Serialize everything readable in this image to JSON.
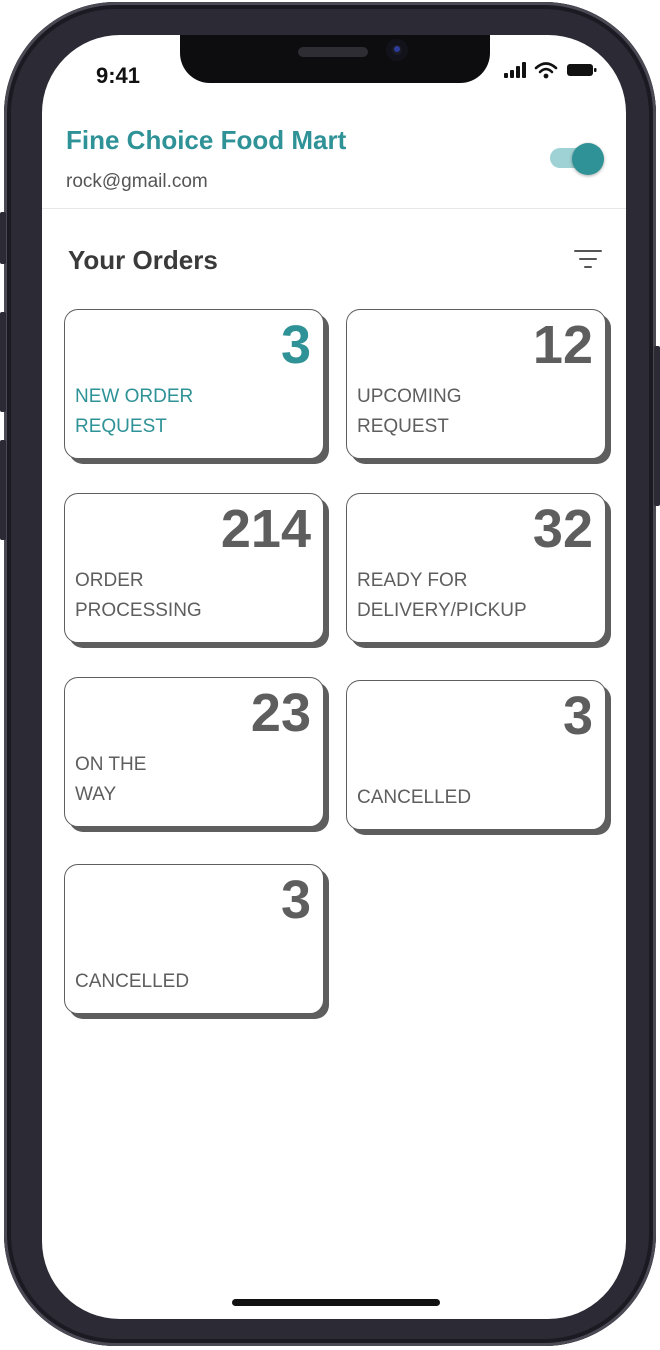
{
  "status_bar": {
    "time": "9:41",
    "icons": [
      "signal-icon",
      "wifi-icon",
      "battery-icon"
    ]
  },
  "header": {
    "store_name": "Fine Choice Food Mart",
    "email": "rock@gmail.com",
    "toggle_on": true
  },
  "orders": {
    "title": "Your Orders",
    "filter_icon": "filter-icon",
    "cards": [
      {
        "count": "3",
        "label_line1": "NEW ORDER",
        "label_line2": "REQUEST"
      },
      {
        "count": "12",
        "label_line1": "UPCOMING",
        "label_line2": "REQUEST"
      },
      {
        "count": "214",
        "label_line1": "ORDER",
        "label_line2": "PROCESSING"
      },
      {
        "count": "32",
        "label_line1": "READY FOR",
        "label_line2": "DELIVERY/PICKUP"
      },
      {
        "count": "23",
        "label_line1": "ON THE",
        "label_line2": "WAY"
      },
      {
        "count": "3",
        "label_line1": "",
        "label_line2": "CANCELLED"
      },
      {
        "count": "3",
        "label_line1": "",
        "label_line2": "CANCELLED"
      }
    ]
  },
  "colors": {
    "accent": "#2f9297",
    "card_border": "#5e5e5e",
    "toggle_track": "#9fd2d4"
  }
}
